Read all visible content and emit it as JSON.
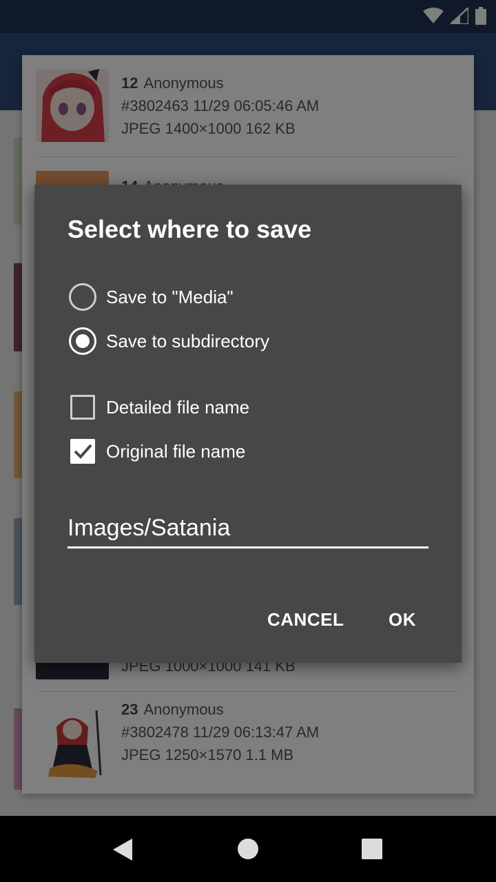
{
  "status": {
    "icons": [
      "wifi-icon",
      "signal-icon",
      "battery-icon"
    ]
  },
  "list": {
    "items": [
      {
        "num": "12",
        "author": "Anonymous",
        "post": "#3802463",
        "date": "11/29 06:05:46 AM",
        "type": "JPEG",
        "dims": "1400×1000",
        "size": "162 KB"
      },
      {
        "num": "14",
        "author": "Anonymous"
      },
      {
        "type": "JPEG",
        "dims": "1000×1000",
        "size": "141 KB"
      },
      {
        "num": "23",
        "author": "Anonymous",
        "post": "#3802478",
        "date": "11/29 06:13:47 AM",
        "type": "JPEG",
        "dims": "1250×1570",
        "size": "1.1 MB"
      }
    ]
  },
  "dialog": {
    "title": "Select where to save",
    "radio_media": "Save to \"Media\"",
    "radio_subdir": "Save to subdirectory",
    "check_detailed": "Detailed file name",
    "check_original": "Original file name",
    "path_value": "Images/Satania",
    "cancel": "CANCEL",
    "ok": "OK"
  },
  "nav": {
    "icons": [
      "back-icon",
      "home-icon",
      "recents-icon"
    ]
  }
}
